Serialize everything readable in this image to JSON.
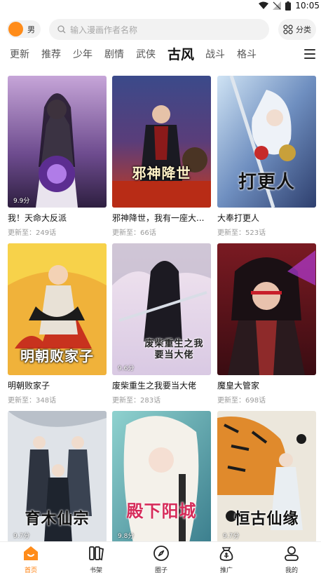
{
  "status_bar": {
    "time": "10:05",
    "icons": [
      "wifi-icon",
      "signal-icon",
      "battery-icon"
    ]
  },
  "search": {
    "gender_label": "男",
    "placeholder": "输入漫画作者名称",
    "category_label": "分类"
  },
  "tabs": [
    {
      "label": "更新"
    },
    {
      "label": "推荐"
    },
    {
      "label": "少年"
    },
    {
      "label": "剧情"
    },
    {
      "label": "武侠"
    },
    {
      "label": "古风",
      "active": true
    },
    {
      "label": "战斗"
    },
    {
      "label": "格斗"
    }
  ],
  "comics": [
    {
      "title": "我！天命大反派",
      "update": "更新至：249话",
      "score": "9.9分"
    },
    {
      "title": "邪神降世，我有一座大...",
      "update": "更新至：66话",
      "cover_text": "邪神降世"
    },
    {
      "title": "大奉打更人",
      "update": "更新至：523话",
      "cover_text": "打更人"
    },
    {
      "title": "明朝败家子",
      "update": "更新至：348话",
      "cover_text": "明朝败家子"
    },
    {
      "title": "废柴重生之我要当大佬",
      "update": "更新至：283话",
      "score": "9.6分",
      "cover_text": "废柴重生之我要当大佬"
    },
    {
      "title": "魔皇大管家",
      "update": "更新至：698话"
    },
    {
      "cover_text": "育木仙宗",
      "score": "9.7分"
    },
    {
      "cover_text": "殿下阳城",
      "score": "9.8分"
    },
    {
      "cover_text": "恒古仙缘",
      "score": "9.7分"
    }
  ],
  "bottom_nav": [
    {
      "label": "首页",
      "icon": "home-icon",
      "active": true
    },
    {
      "label": "书架",
      "icon": "bookshelf-icon"
    },
    {
      "label": "圈子",
      "icon": "compass-icon"
    },
    {
      "label": "推广",
      "icon": "promote-icon"
    },
    {
      "label": "我的",
      "icon": "profile-icon"
    }
  ],
  "colors": {
    "accent": "#ff8c1a",
    "nav_active": "#ff7a00",
    "muted_text": "#999999"
  }
}
